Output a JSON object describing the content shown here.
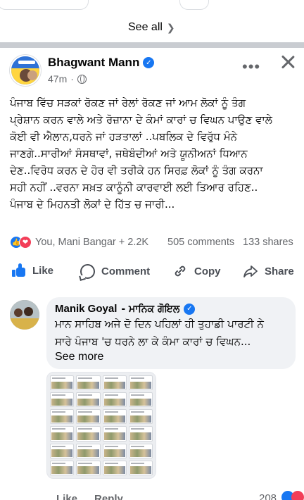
{
  "nav": {
    "see_all": "See all"
  },
  "post": {
    "author": "Bhagwant Mann",
    "time": "47m",
    "more_glyph": "•••",
    "body_lines": [
      "ਪੰਜਾਬ ਵਿੱਚ ਸੜਕਾਂ ਰੋਕਣ ਜਾਂ ਰੇਲਾਂ ਰੋਕਣ ਜਾਂ ਆਮ ਲੋਕਾਂ ਨੂੰ ਤੰਗ",
      "ਪ੍ਰੇਸ਼ਾਨ ਕਰਨ ਵਾਲੇ ਅਤੇ ਰੋਜ਼ਾਨਾ ਦੇ ਕੰਮਾਂ ਕਾਰਾਂ ਚ ਵਿਘਨ ਪਾਉਣ ਵਾਲੇ",
      "ਕੋਈ ਵੀ ਐਲਾਨ,ਧਰਨੇ ਜਾਂ ਹੜਤਾਲਾਂ ..ਪਬਲਿਕ ਦੇ ਵਿਰੁੱਧ ਮੰਨੇ",
      "ਜਾਣਗੇ..ਸਾਰੀਆਂ ਸੰਸਥਾਵਾਂ, ਜਥੇਬੰਦੀਆਂ ਅਤੇ ਯੂਨੀਅਨਾਂ ਧਿਆਨ",
      "ਦੇਣ..ਵਿਰੋਧ ਕਰਨ ਦੇ ਹੋਰ ਵੀ ਤਰੀਕੇ ਹਨ ਸਿਰਫ਼ ਲੋਕਾਂ ਨੂੰ ਤੰਗ ਕਰਨਾ",
      "ਸਹੀ ਨਹੀਂ ..ਵਰਨਾ ਸਖ਼ਤ ਕਾਨੂੰਨੀ ਕਾਰਵਾਈ ਲਈ ਤਿਆਰ ਰਹਿਣ..",
      "ਪੰਜਾਬ ਦੇ ਮਿਹਨਤੀ ਲੋਕਾਂ ਦੇ ਹਿੱਤ ਚ ਜਾਰੀ..."
    ],
    "reactions_text": "You, Mani Bangar + 2.2K",
    "comments_count": "505 comments",
    "shares_count": "133 shares"
  },
  "actions": {
    "like": "Like",
    "comment": "Comment",
    "copy": "Copy",
    "share": "Share"
  },
  "comment": {
    "author": "Manik Goyal",
    "author_alt": "- ਮਾਨਿਕ ਗੋਇਲ",
    "text_lines": [
      "ਮਾਨ ਸਾਹਿਬ ਅਜੇ ਦੋ ਦਿਨ ਪਹਿਲਾਂ ਹੀ ਤੁਹਾਡੀ ਪਾਰਟੀ ਨੇ",
      "ਸਾਰੇ ਪੰਜਾਬ 'ਚ ਧਰਨੇ ਲਾ ਕੇ ਕੰਮਾ ਕਾਰਾਂ ਚ ਵਿਘਨ..."
    ],
    "see_more": "See more",
    "like": "Like",
    "reply": "Reply",
    "reaction_count": "208"
  },
  "colors": {
    "accent": "#1877f2",
    "love": "#f33e58",
    "muted_text": "#65676b",
    "bubble_bg": "#f0f2f5"
  }
}
